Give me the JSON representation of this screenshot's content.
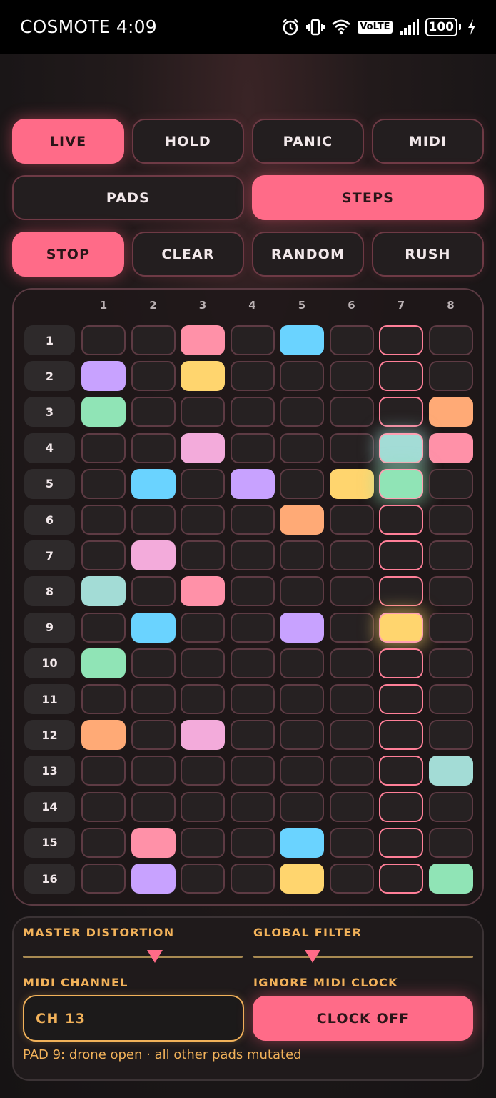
{
  "status_bar": {
    "carrier_time": "COSMOTE 4:09",
    "volte": "VoLTE",
    "battery": "100",
    "icons": [
      "alarm-icon",
      "vibrate-icon",
      "wifi-icon",
      "volte-icon",
      "signal-icon",
      "battery-icon",
      "charging-icon"
    ]
  },
  "mode_buttons": [
    {
      "label": "LIVE",
      "active": true
    },
    {
      "label": "HOLD",
      "active": false
    },
    {
      "label": "PANIC",
      "active": false
    },
    {
      "label": "MIDI",
      "active": false
    }
  ],
  "view_buttons": [
    {
      "label": "PADS",
      "active": false
    },
    {
      "label": "STEPS",
      "active": true
    }
  ],
  "transport_buttons": [
    {
      "label": "STOP",
      "active": true
    },
    {
      "label": "CLEAR",
      "active": false
    },
    {
      "label": "RANDOM",
      "active": false
    },
    {
      "label": "RUSH",
      "active": false
    }
  ],
  "grid": {
    "columns": [
      "1",
      "2",
      "3",
      "4",
      "5",
      "6",
      "7",
      "8"
    ],
    "rows": [
      "1",
      "2",
      "3",
      "4",
      "5",
      "6",
      "7",
      "8",
      "9",
      "10",
      "11",
      "12",
      "13",
      "14",
      "15",
      "16"
    ],
    "playhead_column": 7,
    "palette": {
      "P": "#ff91a8",
      "B": "#6ad3ff",
      "V": "#c8a2ff",
      "Y": "#ffd56e",
      "G": "#90e4b6",
      "O": "#ffaa76",
      "K": "#f3abdb",
      "T": "#a3dcd6"
    },
    "cells": [
      "..P.B...",
      "V.Y.....",
      "G......O",
      "..K...TP",
      ".B.V.YG.",
      "....O...",
      ".K......",
      "T.P.....",
      ".B..V.Y.",
      "G.......",
      "........",
      "O.K.....",
      ".......T",
      "........",
      ".P..B...",
      ".V..Y..G"
    ],
    "glowing": [
      [
        4,
        7
      ],
      [
        5,
        7
      ],
      [
        9,
        7
      ]
    ]
  },
  "controls": {
    "distortion_label": "MASTER DISTORTION",
    "distortion_value": 0.6,
    "filter_label": "GLOBAL FILTER",
    "filter_value": 0.27,
    "channel_label": "MIDI CHANNEL",
    "channel_value": "CH 13",
    "clock_label": "IGNORE MIDI CLOCK",
    "clock_button": "CLOCK OFF",
    "status_text": "PAD 9: drone open · all other pads mutated"
  },
  "colors": {
    "accent": "#ff6b88",
    "gold": "#f2b25a",
    "playhead": "#ff7f98"
  }
}
